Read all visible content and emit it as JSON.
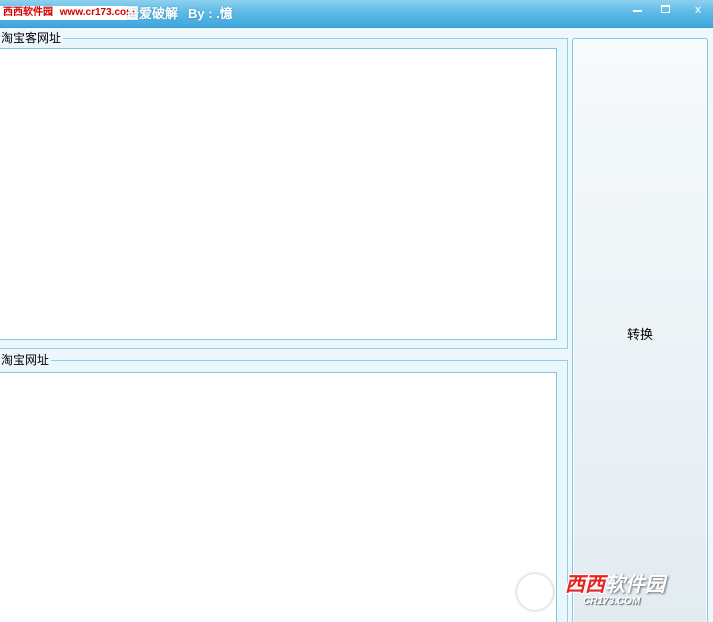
{
  "watermark": {
    "site_name": "西西软件园",
    "site_url": "www.cr173.com"
  },
  "window": {
    "title_suffix": "吾爱破解",
    "author": "By : .憶",
    "minimize_icon": "minimize-icon",
    "maximize_icon": "maximize-icon",
    "close_label": "x"
  },
  "groups": {
    "taobaoke_url_label": "淘宝客网址",
    "taobaoke_url_value": "",
    "taobao_url_label": "淘宝网址",
    "taobao_url_value": ""
  },
  "convert_button": {
    "label": "转换"
  },
  "logo": {
    "brand_red": "西西",
    "brand_white": "软件园",
    "domain": "CR173.COM"
  },
  "colors": {
    "titlebar": "#5cbbe7",
    "group_border": "#8fcfe8",
    "watermark_red": "#d40000"
  }
}
